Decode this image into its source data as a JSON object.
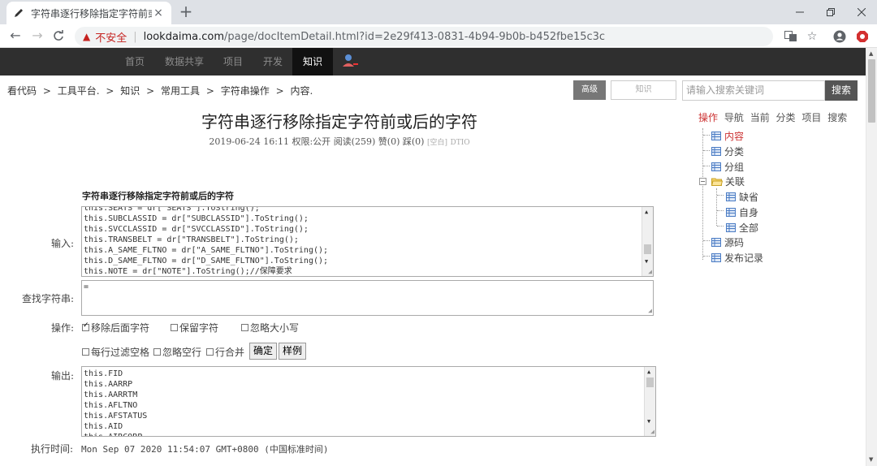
{
  "browser": {
    "tab_title": "字符串逐行移除指定字符前或后的",
    "tab_close": "×",
    "new_tab": "+",
    "insecure_label": "不安全",
    "url_domain": "lookdaima.com",
    "url_path": "/page/docItemDetail.html?id=2e29f413-0831-4b94-9b0b-b452fbe15c3c"
  },
  "site_nav": {
    "items": [
      "首页",
      "数据共享",
      "项目",
      "开发",
      "知识"
    ],
    "active_index": 4
  },
  "breadcrumb": [
    "看代码",
    ">",
    "工具平台.",
    ">",
    "知识",
    ">",
    "常用工具",
    ">",
    "字符串操作",
    ">",
    "内容."
  ],
  "search": {
    "advanced_label": "高级",
    "scope_label": "知识",
    "placeholder": "请输入搜索关键词",
    "button_label": "搜索"
  },
  "doc": {
    "title": "字符串逐行移除指定字符前或后的字符",
    "date": "2019-06-24 16:11",
    "permission": "权限:公开",
    "reads": "阅读(259)",
    "likes": "赞(0)",
    "dislikes": "踩(0)",
    "extra1": "[空白]",
    "extra2": "DTIO",
    "section_title": "字符串逐行移除指定字符前或后的字符"
  },
  "form": {
    "input_label": "输入:",
    "input_lines": [
      "this.SEATS = dr[\"SEATS\"].ToString();",
      "this.SUBCLASSID = dr[\"SUBCLASSID\"].ToString();",
      "this.SVCCLASSID = dr[\"SVCCLASSID\"].ToString();",
      "this.TRANSBELT = dr[\"TRANSBELT\"].ToString();",
      "this.A_SAME_FLTNO = dr[\"A_SAME_FLTNO\"].ToString();",
      "this.D_SAME_FLTNO = dr[\"D_SAME_FLTNO\"].ToString();",
      "this.NOTE = dr[\"NOTE\"].ToString();//保障要求"
    ],
    "find_label": "查找字符串:",
    "find_value": "=",
    "ops_label": "操作:",
    "options_row1": [
      {
        "label": "移除后面字符",
        "checked": true
      },
      {
        "label": "保留字符",
        "checked": false
      },
      {
        "label": "忽略大小写",
        "checked": false
      }
    ],
    "options_row2": [
      {
        "label": "每行过滤空格",
        "checked": false
      },
      {
        "label": "忽略空行",
        "checked": false
      },
      {
        "label": "行合并",
        "checked": false
      }
    ],
    "confirm_label": "确定",
    "example_label": "样例",
    "output_label": "输出:",
    "output_lines": [
      "this.FID",
      "this.AARRP",
      "this.AARRTM",
      "this.AFLTNO",
      "this.AFSTATUS",
      "this.AID",
      "this.AIRCORP"
    ],
    "exec_label": "执行时间:",
    "exec_value": "Mon Sep 07 2020 11:54:07 GMT+0800 (中国标准时间)"
  },
  "sidebar": {
    "tabs": [
      "操作",
      "导航",
      "当前",
      "分类",
      "项目",
      "搜索"
    ],
    "active_tab": 0,
    "tree": [
      {
        "label": "内容",
        "active": true
      },
      {
        "label": "分类"
      },
      {
        "label": "分组"
      },
      {
        "label": "关联",
        "folder": true
      },
      {
        "label": "缺省",
        "child": true
      },
      {
        "label": "自身",
        "child": true
      },
      {
        "label": "全部",
        "child": true
      },
      {
        "label": "源码"
      },
      {
        "label": "发布记录"
      }
    ],
    "toggle": "−"
  }
}
